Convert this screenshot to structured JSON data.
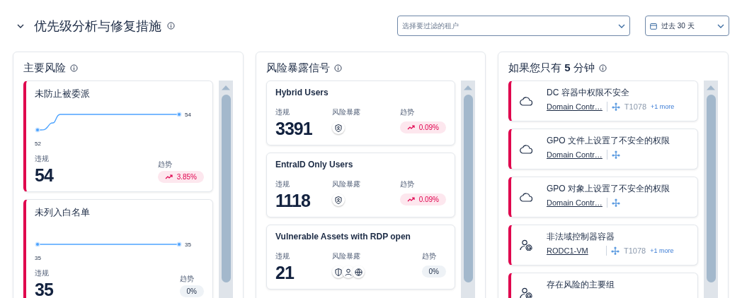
{
  "header": {
    "title": "优先级分析与修复措施",
    "tenant_filter": {
      "placeholder": "选择要过滤的租户"
    },
    "date_filter": {
      "value": "过去 30 天"
    }
  },
  "top_risks": {
    "title": "主要风险",
    "cards": [
      {
        "title": "未防止被委派",
        "start_label": "52",
        "end_label": "54",
        "violations_label": "违规",
        "violations": "54",
        "trend_label": "趋势",
        "trend": {
          "rising": true,
          "value": "3.85%"
        }
      },
      {
        "title": "未列入白名单",
        "start_label": "35",
        "end_label": "35",
        "violations_label": "违规",
        "violations": "35",
        "trend_label": "趋势",
        "trend": {
          "rising": false,
          "value": "0%"
        }
      }
    ]
  },
  "exposure_signals": {
    "title": "风险暴露信号",
    "cards": [
      {
        "title": "Hybrid Users",
        "violations_label": "违规",
        "violations": "3391",
        "exposure_label": "风险暴露",
        "exposure_icons": [
          {
            "kind": "shield-user"
          }
        ],
        "trend_label": "趋势",
        "trend": {
          "rising": true,
          "value": "0.09%"
        }
      },
      {
        "title": "EntraID Only Users",
        "violations_label": "违规",
        "violations": "1118",
        "exposure_label": "风险暴露",
        "exposure_icons": [
          {
            "kind": "shield-user"
          }
        ],
        "trend_label": "趋势",
        "trend": {
          "rising": true,
          "value": "0.09%"
        }
      },
      {
        "title": "Vulnerable Assets with RDP open",
        "violations_label": "违规",
        "violations": "21",
        "exposure_label": "风险暴露",
        "exposure_icons": [
          {
            "kind": "shield"
          },
          {
            "kind": "user"
          },
          {
            "kind": "globe"
          }
        ],
        "trend_label": "趋势",
        "trend": {
          "rising": false,
          "value": "0%"
        }
      }
    ]
  },
  "five_minutes": {
    "title_before": "如果您只有",
    "title_bold": "5",
    "title_after": "分钟",
    "items": [
      {
        "kind": "cloud",
        "title": "DC 容器中权限不安全",
        "target": "Domain Contr…",
        "technique": "T1078",
        "more": "+1 more"
      },
      {
        "kind": "cloud",
        "title": "GPO 文件上设置了不安全的权限",
        "target": "Domain Contr…"
      },
      {
        "kind": "cloud",
        "title": "GPO 对象上设置了不安全的权限",
        "target": "Domain Contr…"
      },
      {
        "kind": "user",
        "title": "非法域控制器容器",
        "target": "RODC1-VM",
        "technique": "T1078",
        "more": "+1 more"
      },
      {
        "kind": "user",
        "title": "存在风险的主要组"
      }
    ]
  }
}
